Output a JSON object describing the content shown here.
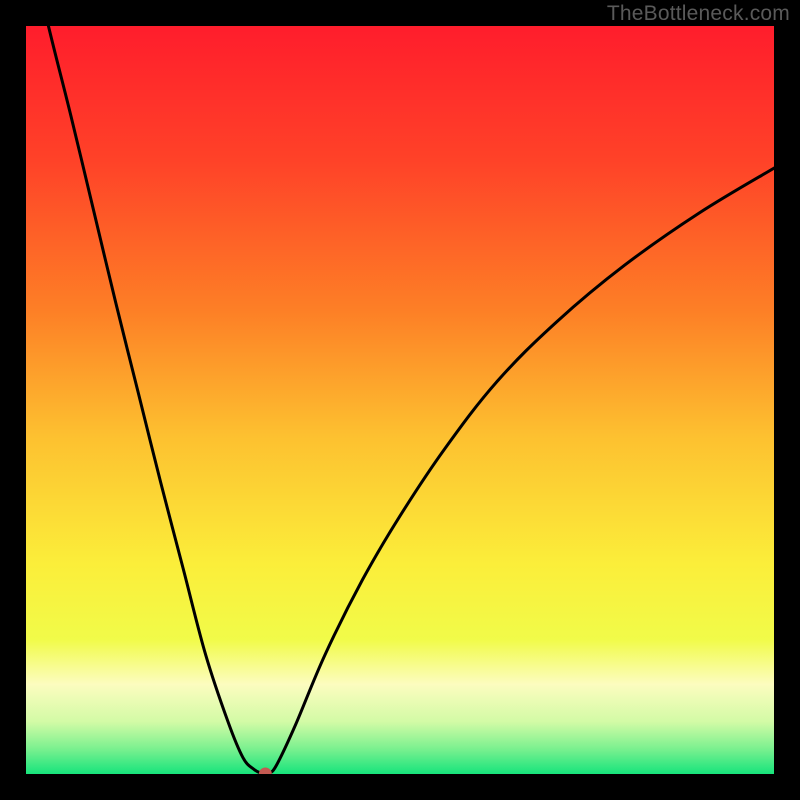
{
  "watermark": "TheBottleneck.com",
  "chart_data": {
    "type": "line",
    "title": "",
    "xlabel": "",
    "ylabel": "",
    "xlim": [
      0,
      100
    ],
    "ylim": [
      0,
      100
    ],
    "marker": {
      "x": 32,
      "y": 0,
      "color": "#c45a52",
      "radius": 6.5
    },
    "gradient_stops": [
      {
        "offset": 0.0,
        "color": "#ff1d2c"
      },
      {
        "offset": 0.18,
        "color": "#ff4228"
      },
      {
        "offset": 0.38,
        "color": "#fd7f26"
      },
      {
        "offset": 0.55,
        "color": "#fdc130"
      },
      {
        "offset": 0.72,
        "color": "#fbee3a"
      },
      {
        "offset": 0.82,
        "color": "#f1fb49"
      },
      {
        "offset": 0.88,
        "color": "#fcfcbf"
      },
      {
        "offset": 0.93,
        "color": "#d3fba6"
      },
      {
        "offset": 0.965,
        "color": "#7ef190"
      },
      {
        "offset": 1.0,
        "color": "#17e47c"
      }
    ],
    "series": [
      {
        "name": "curve",
        "x": [
          0,
          3,
          6,
          9,
          12,
          15,
          18,
          21,
          24,
          27,
          29,
          30.5,
          31.5,
          32,
          32.5,
          33.5,
          36,
          40,
          45,
          50,
          56,
          63,
          71,
          80,
          90,
          100
        ],
        "y": [
          113,
          100,
          88,
          75.5,
          63,
          51,
          39,
          27.5,
          16,
          7,
          2.2,
          0.6,
          0.1,
          0,
          0.1,
          1.2,
          6.5,
          16,
          26,
          34.5,
          43.5,
          52.5,
          60.5,
          68,
          75,
          81
        ]
      }
    ]
  }
}
